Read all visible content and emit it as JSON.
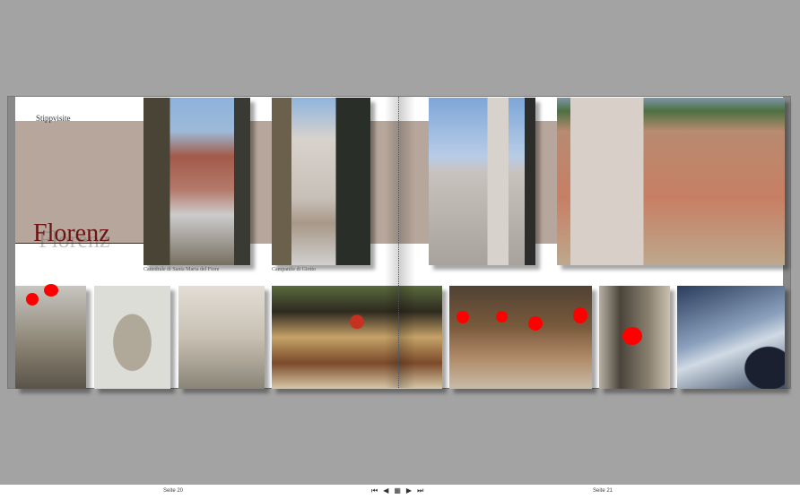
{
  "album": {
    "subtitle": "Stippvisite",
    "title": "Florenz",
    "captions": [
      "Cattedrale di Santa Maria del Fiore",
      "Campanile di Giotto"
    ],
    "band_color": "#b7a69b",
    "title_color": "#6b1414"
  },
  "footer": {
    "left_page": "Seite 20",
    "right_page": "Seite 21",
    "nav": {
      "first": "⏮",
      "prev": "◀",
      "overview": "▦",
      "next": "▶",
      "last": "⏭"
    }
  }
}
